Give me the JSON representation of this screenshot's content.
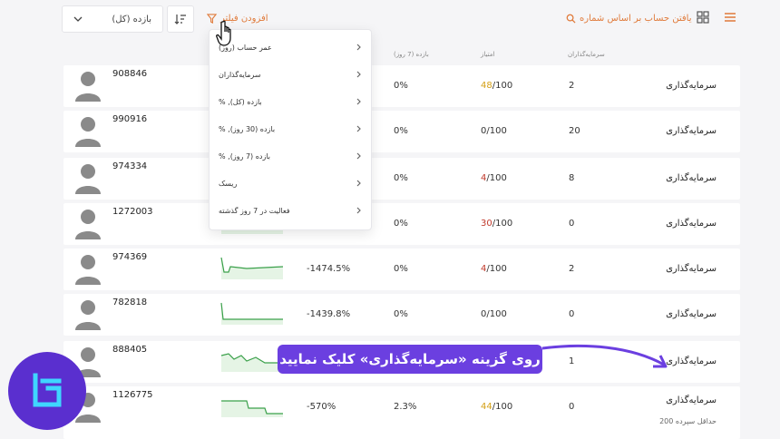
{
  "toolbar": {
    "sort_select_value": "بازده (کل)",
    "add_filter_label": "افزودن فیلتر",
    "search_label": "یافتن حساب بر اساس شماره"
  },
  "columns": {
    "gain7": "بازده (7 روز)",
    "rating": "امتیاز",
    "investors": "سرمایه‌گذاران"
  },
  "filter_menu": {
    "items": [
      "عمر حساب (روز)",
      "سرمایه‌گذاران",
      "% ,بازده (کل)",
      "% ,بازده (30 روز)",
      "% ,بازده (7 روز)",
      "ریسک",
      "فعالیت در 7 روز گذشته"
    ]
  },
  "rows": [
    {
      "account": "908846",
      "growth": "",
      "gain7": "0%",
      "rating_score": "48",
      "rating_suffix": "/100",
      "investors": "2",
      "action": "سرمایه‌گذاری",
      "sub": ""
    },
    {
      "account": "990916",
      "growth": "",
      "gain7": "0%",
      "rating_score": "0",
      "rating_suffix": "/100",
      "investors": "20",
      "action": "سرمایه‌گذاری",
      "sub": ""
    },
    {
      "account": "974334",
      "growth": "",
      "gain7": "0%",
      "rating_score": "4",
      "rating_suffix": "/100",
      "investors": "8",
      "action": "سرمایه‌گذاری",
      "sub": ""
    },
    {
      "account": "1272003",
      "growth": "",
      "gain7": "0%",
      "rating_score": "30",
      "rating_suffix": "/100",
      "investors": "0",
      "action": "سرمایه‌گذاری",
      "sub": ""
    },
    {
      "account": "974369",
      "growth": "-1474.5%",
      "gain7": "0%",
      "rating_score": "4",
      "rating_suffix": "/100",
      "investors": "2",
      "action": "سرمایه‌گذاری",
      "sub": ""
    },
    {
      "account": "782818",
      "growth": "-1439.8%",
      "gain7": "0%",
      "rating_score": "0",
      "rating_suffix": "/100",
      "investors": "0",
      "action": "سرمایه‌گذاری",
      "sub": ""
    },
    {
      "account": "888405",
      "growth": "",
      "gain7": "",
      "rating_score": "",
      "rating_suffix": "",
      "investors": "1",
      "action": "سرمایه‌گذاری",
      "sub": ""
    },
    {
      "account": "1126775",
      "growth": "-570%",
      "gain7": "2.3%",
      "rating_score": "44",
      "rating_suffix": "/100",
      "investors": "0",
      "action": "سرمایه‌گذاری",
      "sub": "حداقل سپرده 200"
    }
  ],
  "annotation": {
    "text": "روی گزینه «سرمایه‌گذاری» کلیک نمایید"
  },
  "colors": {
    "accent": "#e07a3a",
    "score_high": "#d4a017",
    "score_mid": "#c0392b",
    "callout_bg": "#6b3fe0",
    "logo_bg": "#5a2fcf",
    "logo_fg": "#3fd6ff"
  },
  "icons": [
    "chevron-down-icon",
    "sort-icon",
    "filter-icon",
    "search-icon",
    "grid-view-icon",
    "list-view-icon",
    "chevron-left-icon",
    "user-avatar-icon",
    "hand-cursor-icon",
    "curved-arrow-icon",
    "brand-logo-icon"
  ]
}
